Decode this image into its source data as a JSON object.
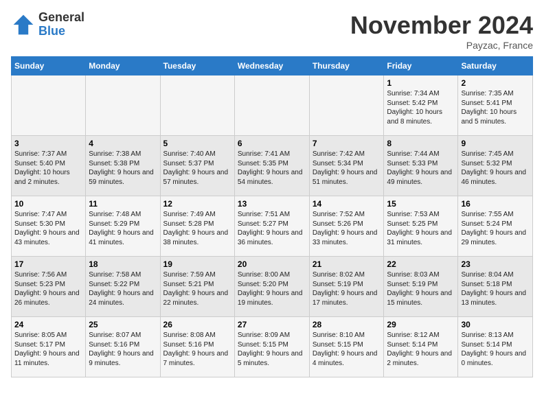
{
  "logo": {
    "general": "General",
    "blue": "Blue"
  },
  "header": {
    "month": "November 2024",
    "location": "Payzac, France"
  },
  "weekdays": [
    "Sunday",
    "Monday",
    "Tuesday",
    "Wednesday",
    "Thursday",
    "Friday",
    "Saturday"
  ],
  "weeks": [
    [
      {
        "day": "",
        "text": ""
      },
      {
        "day": "",
        "text": ""
      },
      {
        "day": "",
        "text": ""
      },
      {
        "day": "",
        "text": ""
      },
      {
        "day": "",
        "text": ""
      },
      {
        "day": "1",
        "text": "Sunrise: 7:34 AM\nSunset: 5:42 PM\nDaylight: 10 hours and 8 minutes."
      },
      {
        "day": "2",
        "text": "Sunrise: 7:35 AM\nSunset: 5:41 PM\nDaylight: 10 hours and 5 minutes."
      }
    ],
    [
      {
        "day": "3",
        "text": "Sunrise: 7:37 AM\nSunset: 5:40 PM\nDaylight: 10 hours and 2 minutes."
      },
      {
        "day": "4",
        "text": "Sunrise: 7:38 AM\nSunset: 5:38 PM\nDaylight: 9 hours and 59 minutes."
      },
      {
        "day": "5",
        "text": "Sunrise: 7:40 AM\nSunset: 5:37 PM\nDaylight: 9 hours and 57 minutes."
      },
      {
        "day": "6",
        "text": "Sunrise: 7:41 AM\nSunset: 5:35 PM\nDaylight: 9 hours and 54 minutes."
      },
      {
        "day": "7",
        "text": "Sunrise: 7:42 AM\nSunset: 5:34 PM\nDaylight: 9 hours and 51 minutes."
      },
      {
        "day": "8",
        "text": "Sunrise: 7:44 AM\nSunset: 5:33 PM\nDaylight: 9 hours and 49 minutes."
      },
      {
        "day": "9",
        "text": "Sunrise: 7:45 AM\nSunset: 5:32 PM\nDaylight: 9 hours and 46 minutes."
      }
    ],
    [
      {
        "day": "10",
        "text": "Sunrise: 7:47 AM\nSunset: 5:30 PM\nDaylight: 9 hours and 43 minutes."
      },
      {
        "day": "11",
        "text": "Sunrise: 7:48 AM\nSunset: 5:29 PM\nDaylight: 9 hours and 41 minutes."
      },
      {
        "day": "12",
        "text": "Sunrise: 7:49 AM\nSunset: 5:28 PM\nDaylight: 9 hours and 38 minutes."
      },
      {
        "day": "13",
        "text": "Sunrise: 7:51 AM\nSunset: 5:27 PM\nDaylight: 9 hours and 36 minutes."
      },
      {
        "day": "14",
        "text": "Sunrise: 7:52 AM\nSunset: 5:26 PM\nDaylight: 9 hours and 33 minutes."
      },
      {
        "day": "15",
        "text": "Sunrise: 7:53 AM\nSunset: 5:25 PM\nDaylight: 9 hours and 31 minutes."
      },
      {
        "day": "16",
        "text": "Sunrise: 7:55 AM\nSunset: 5:24 PM\nDaylight: 9 hours and 29 minutes."
      }
    ],
    [
      {
        "day": "17",
        "text": "Sunrise: 7:56 AM\nSunset: 5:23 PM\nDaylight: 9 hours and 26 minutes."
      },
      {
        "day": "18",
        "text": "Sunrise: 7:58 AM\nSunset: 5:22 PM\nDaylight: 9 hours and 24 minutes."
      },
      {
        "day": "19",
        "text": "Sunrise: 7:59 AM\nSunset: 5:21 PM\nDaylight: 9 hours and 22 minutes."
      },
      {
        "day": "20",
        "text": "Sunrise: 8:00 AM\nSunset: 5:20 PM\nDaylight: 9 hours and 19 minutes."
      },
      {
        "day": "21",
        "text": "Sunrise: 8:02 AM\nSunset: 5:19 PM\nDaylight: 9 hours and 17 minutes."
      },
      {
        "day": "22",
        "text": "Sunrise: 8:03 AM\nSunset: 5:19 PM\nDaylight: 9 hours and 15 minutes."
      },
      {
        "day": "23",
        "text": "Sunrise: 8:04 AM\nSunset: 5:18 PM\nDaylight: 9 hours and 13 minutes."
      }
    ],
    [
      {
        "day": "24",
        "text": "Sunrise: 8:05 AM\nSunset: 5:17 PM\nDaylight: 9 hours and 11 minutes."
      },
      {
        "day": "25",
        "text": "Sunrise: 8:07 AM\nSunset: 5:16 PM\nDaylight: 9 hours and 9 minutes."
      },
      {
        "day": "26",
        "text": "Sunrise: 8:08 AM\nSunset: 5:16 PM\nDaylight: 9 hours and 7 minutes."
      },
      {
        "day": "27",
        "text": "Sunrise: 8:09 AM\nSunset: 5:15 PM\nDaylight: 9 hours and 5 minutes."
      },
      {
        "day": "28",
        "text": "Sunrise: 8:10 AM\nSunset: 5:15 PM\nDaylight: 9 hours and 4 minutes."
      },
      {
        "day": "29",
        "text": "Sunrise: 8:12 AM\nSunset: 5:14 PM\nDaylight: 9 hours and 2 minutes."
      },
      {
        "day": "30",
        "text": "Sunrise: 8:13 AM\nSunset: 5:14 PM\nDaylight: 9 hours and 0 minutes."
      }
    ]
  ]
}
